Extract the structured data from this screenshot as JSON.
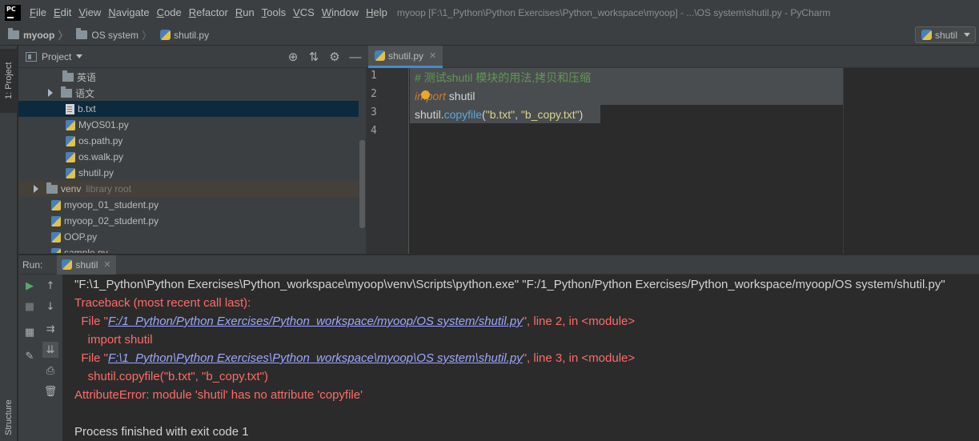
{
  "menubar": {
    "logo_text": "PC",
    "items": [
      {
        "label": "File",
        "ul": "F",
        "rest": "ile"
      },
      {
        "label": "Edit",
        "ul": "E",
        "rest": "dit"
      },
      {
        "label": "View",
        "ul": "V",
        "rest": "iew"
      },
      {
        "label": "Navigate",
        "ul": "N",
        "rest": "avigate"
      },
      {
        "label": "Code",
        "ul": "C",
        "rest": "ode"
      },
      {
        "label": "Refactor",
        "ul": "R",
        "rest": "efactor"
      },
      {
        "label": "Run",
        "ul": "R",
        "rest": "un"
      },
      {
        "label": "Tools",
        "ul": "T",
        "rest": "ools"
      },
      {
        "label": "VCS",
        "ul": "V",
        "rest": "CS"
      },
      {
        "label": "Window",
        "ul": "W",
        "rest": "indow"
      },
      {
        "label": "Help",
        "ul": "H",
        "rest": "elp"
      }
    ],
    "window_title": "myoop [F:\\1_Python\\Python Exercises\\Python_workspace\\myoop] - ...\\OS system\\shutil.py - PyCharm"
  },
  "navbar": {
    "crumbs": [
      "myoop",
      "OS system",
      "shutil.py"
    ],
    "run_config": "shutil"
  },
  "left_stripe": {
    "project_tab": "1: Project",
    "structure_tab": "Structure"
  },
  "project_panel": {
    "title": "Project",
    "tools": [
      "crosshair-icon",
      "collapse-icon",
      "gear-icon",
      "minimize-icon"
    ],
    "tree": [
      {
        "label": "英语",
        "type": "folder",
        "indent": 55,
        "arrow": false
      },
      {
        "label": "语文",
        "type": "folder",
        "indent": 37,
        "arrow": true
      },
      {
        "label": "b.txt",
        "type": "txt",
        "indent": 59,
        "arrow": false,
        "selected": true
      },
      {
        "label": "MyOS01.py",
        "type": "py",
        "indent": 59,
        "arrow": false
      },
      {
        "label": "os.path.py",
        "type": "py",
        "indent": 59,
        "arrow": false
      },
      {
        "label": "os.walk.py",
        "type": "py",
        "indent": 59,
        "arrow": false
      },
      {
        "label": "shutil.py",
        "type": "py",
        "indent": 59,
        "arrow": false
      },
      {
        "label": "venv",
        "type": "folder",
        "indent": 19,
        "arrow": true,
        "extra": "library root",
        "venv": true
      },
      {
        "label": "myoop_01_student.py",
        "type": "py",
        "indent": 41,
        "arrow": false
      },
      {
        "label": "myoop_02_student.py",
        "type": "py",
        "indent": 41,
        "arrow": false
      },
      {
        "label": "OOP.py",
        "type": "py",
        "indent": 41,
        "arrow": false
      },
      {
        "label": "sample.py",
        "type": "py",
        "indent": 41,
        "arrow": false
      }
    ]
  },
  "editor": {
    "tab_label": "shutil.py",
    "line_numbers": [
      "1",
      "2",
      "3",
      "4"
    ],
    "line1_comment": "# 测试shutil 模块的用法,拷贝和压缩",
    "line2_keyword": "import",
    "line2_module": " shutil",
    "line3_obj": "shutil",
    "line3_dot": ".",
    "line3_func": "copyfile",
    "line3_open": "(",
    "line3_arg1": "\"b.txt\"",
    "line3_comma": ", ",
    "line3_arg2": "\"b_copy.txt\"",
    "line3_close": ")"
  },
  "run_panel": {
    "label": "Run:",
    "tab_label": "shutil",
    "console": {
      "cmd": "\"F:\\1_Python\\Python Exercises\\Python_workspace\\myoop\\venv\\Scripts\\python.exe\" \"F:/1_Python/Python Exercises/Python_workspace/myoop/OS system/shutil.py\"",
      "traceback": "Traceback (most recent call last):",
      "file1_prefix": "  File \"",
      "file1_link": "F:/1_Python/Python Exercises/Python_workspace/myoop/OS system/shutil.py",
      "file1_suffix": "\", line 2, in <module>",
      "code1": "    import shutil",
      "file2_prefix": "  File \"",
      "file2_link": "F:\\1_Python\\Python Exercises\\Python_workspace\\myoop\\OS system\\shutil.py",
      "file2_suffix": "\", line 3, in <module>",
      "code2": "    shutil.copyfile(\"b.txt\", \"b_copy.txt\")",
      "error": "AttributeError: module 'shutil' has no attribute 'copyfile'",
      "finish": "Process finished with exit code 1"
    }
  }
}
